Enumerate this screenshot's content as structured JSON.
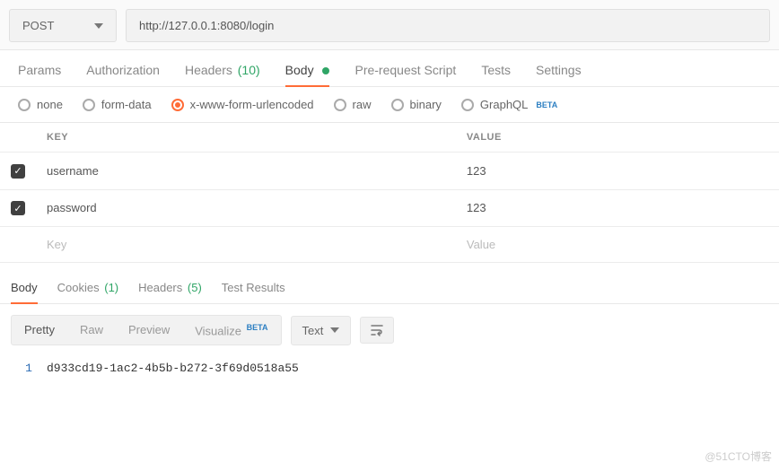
{
  "request": {
    "method": "POST",
    "url": "http://127.0.0.1:8080/login"
  },
  "reqTabs": {
    "params": "Params",
    "auth": "Authorization",
    "headers": "Headers",
    "headersCount": "(10)",
    "body": "Body",
    "prereq": "Pre-request Script",
    "tests": "Tests",
    "settings": "Settings"
  },
  "bodyTypes": {
    "none": "none",
    "formdata": "form-data",
    "urlencoded": "x-www-form-urlencoded",
    "raw": "raw",
    "binary": "binary",
    "graphql": "GraphQL",
    "beta": "BETA"
  },
  "kv": {
    "keyHeader": "KEY",
    "valueHeader": "VALUE",
    "rows": [
      {
        "key": "username",
        "value": "123"
      },
      {
        "key": "password",
        "value": "123"
      }
    ],
    "keyPlaceholder": "Key",
    "valuePlaceholder": "Value"
  },
  "respTabs": {
    "body": "Body",
    "cookies": "Cookies",
    "cookiesCount": "(1)",
    "headers": "Headers",
    "headersCount": "(5)",
    "tests": "Test Results"
  },
  "fmtTabs": {
    "pretty": "Pretty",
    "raw": "Raw",
    "preview": "Preview",
    "visualize": "Visualize",
    "beta": "BETA"
  },
  "respType": "Text",
  "response": {
    "lineNum": "1",
    "content": "d933cd19-1ac2-4b5b-b272-3f69d0518a55"
  },
  "watermark": "@51CTO博客"
}
